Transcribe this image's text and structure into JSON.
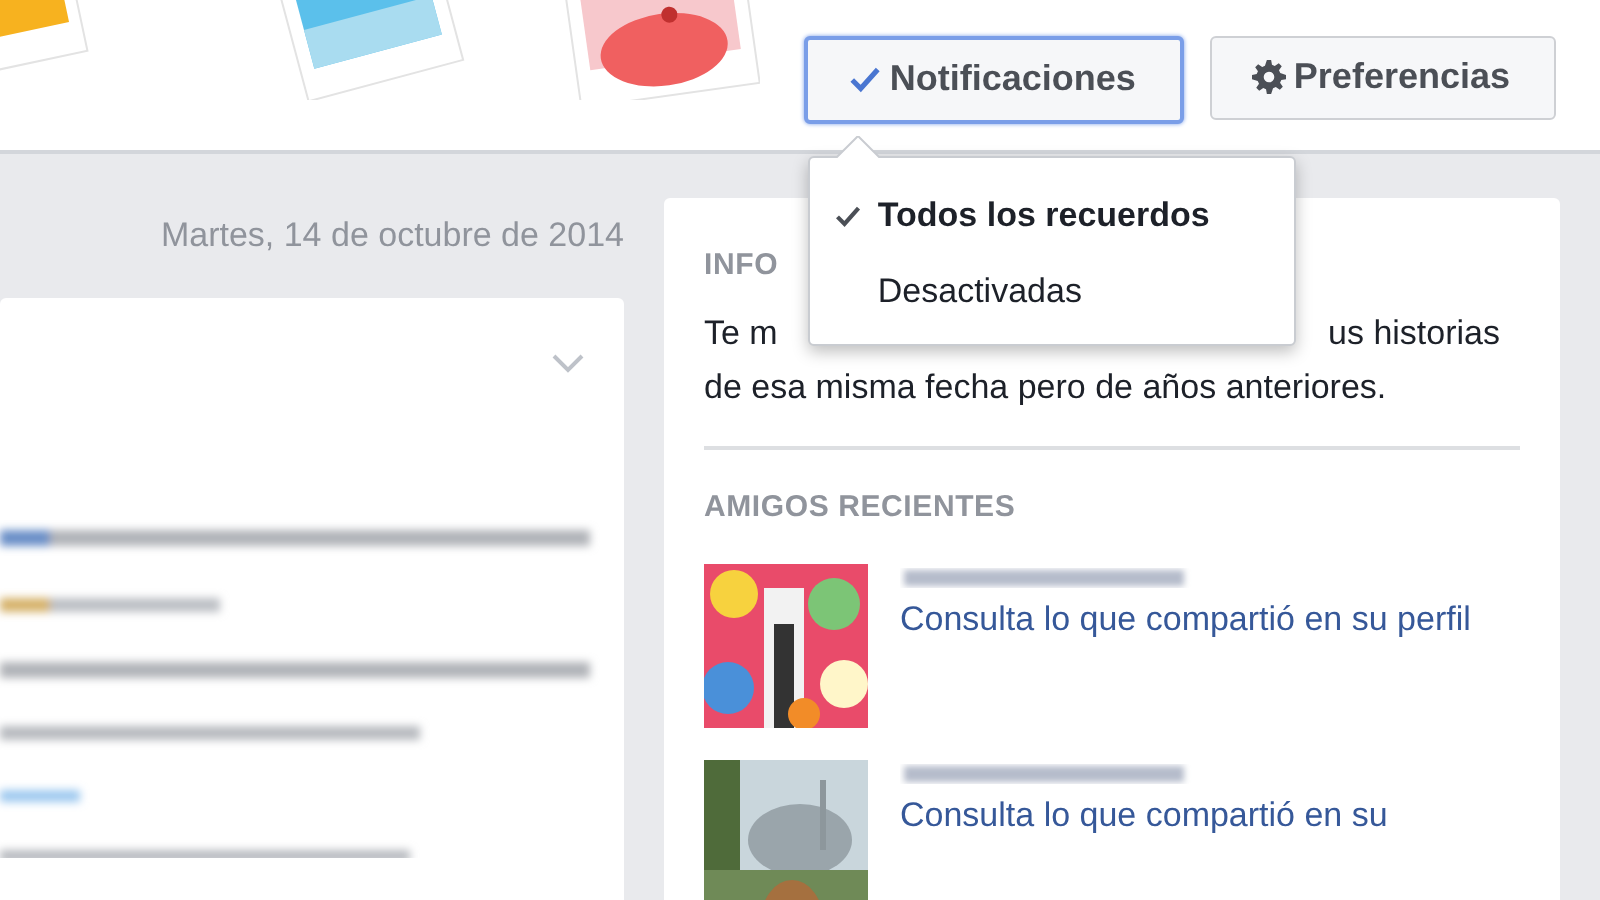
{
  "header": {
    "buttons": [
      {
        "kind": "check",
        "label": "Notificaciones",
        "selected": true
      },
      {
        "kind": "gear",
        "label": "Preferencias",
        "selected": false
      }
    ]
  },
  "dropdown": {
    "options": [
      {
        "label": "Todos los recuerdos",
        "selected": true
      },
      {
        "label": "Desactivadas",
        "selected": false
      }
    ]
  },
  "date": "Martes, 14 de octubre de 2014",
  "info": {
    "heading": "INFO",
    "text_parts": [
      "Te m",
      "us historias",
      "de esa misma fecha pero de años anteriores."
    ]
  },
  "recent_friends": {
    "heading": "AMIGOS RECIENTES",
    "items": [
      {
        "kind": "picture",
        "link": "Consulta lo que compartió en su perfil"
      },
      {
        "kind": "picture",
        "link": "Consulta lo que compartió en su"
      }
    ]
  }
}
